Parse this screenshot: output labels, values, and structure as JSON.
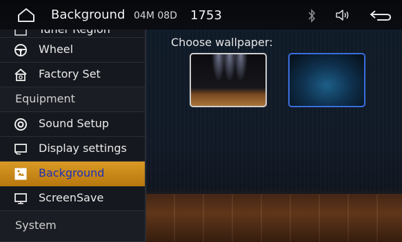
{
  "topbar": {
    "title": "Background",
    "date": "04M 08D",
    "time": "1753"
  },
  "sidebar": {
    "partial_item_label": "Tuner Region",
    "items": [
      {
        "label": "Wheel",
        "icon": "steering-wheel-icon"
      },
      {
        "label": "Factory Set",
        "icon": "factory-icon"
      },
      {
        "label": "Equipment",
        "section": true
      },
      {
        "label": "Sound Setup",
        "icon": "speaker-icon"
      },
      {
        "label": "Display settings",
        "icon": "monitor-icon"
      },
      {
        "label": "Background",
        "icon": "background-icon",
        "active": true
      },
      {
        "label": "ScreenSave",
        "icon": "monitor-icon"
      },
      {
        "label": "System",
        "section": true
      }
    ]
  },
  "main": {
    "prompt": "Choose wallpaper:",
    "wallpapers": [
      {
        "name": "stage-wallpaper",
        "selected": false
      },
      {
        "name": "blue-wallpaper",
        "selected": true
      }
    ]
  },
  "colors": {
    "active_bg": "#d39018",
    "active_text": "#1b2fb8",
    "selected_border": "#3a6fe0"
  }
}
